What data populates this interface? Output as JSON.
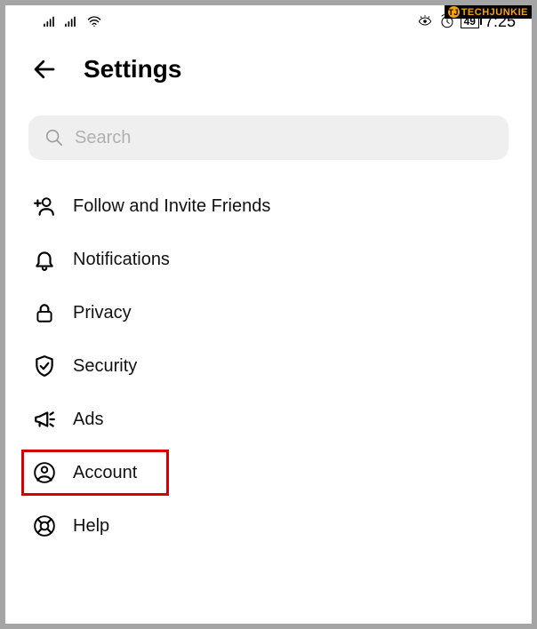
{
  "watermark": {
    "badge": "TJ",
    "text": "TECHJUNKIE"
  },
  "status": {
    "battery": "49",
    "clock": "7:25"
  },
  "header": {
    "title": "Settings"
  },
  "search": {
    "placeholder": "Search"
  },
  "menu": {
    "items": [
      {
        "label": "Follow and Invite Friends"
      },
      {
        "label": "Notifications"
      },
      {
        "label": "Privacy"
      },
      {
        "label": "Security"
      },
      {
        "label": "Ads"
      },
      {
        "label": "Account"
      },
      {
        "label": "Help"
      }
    ]
  }
}
